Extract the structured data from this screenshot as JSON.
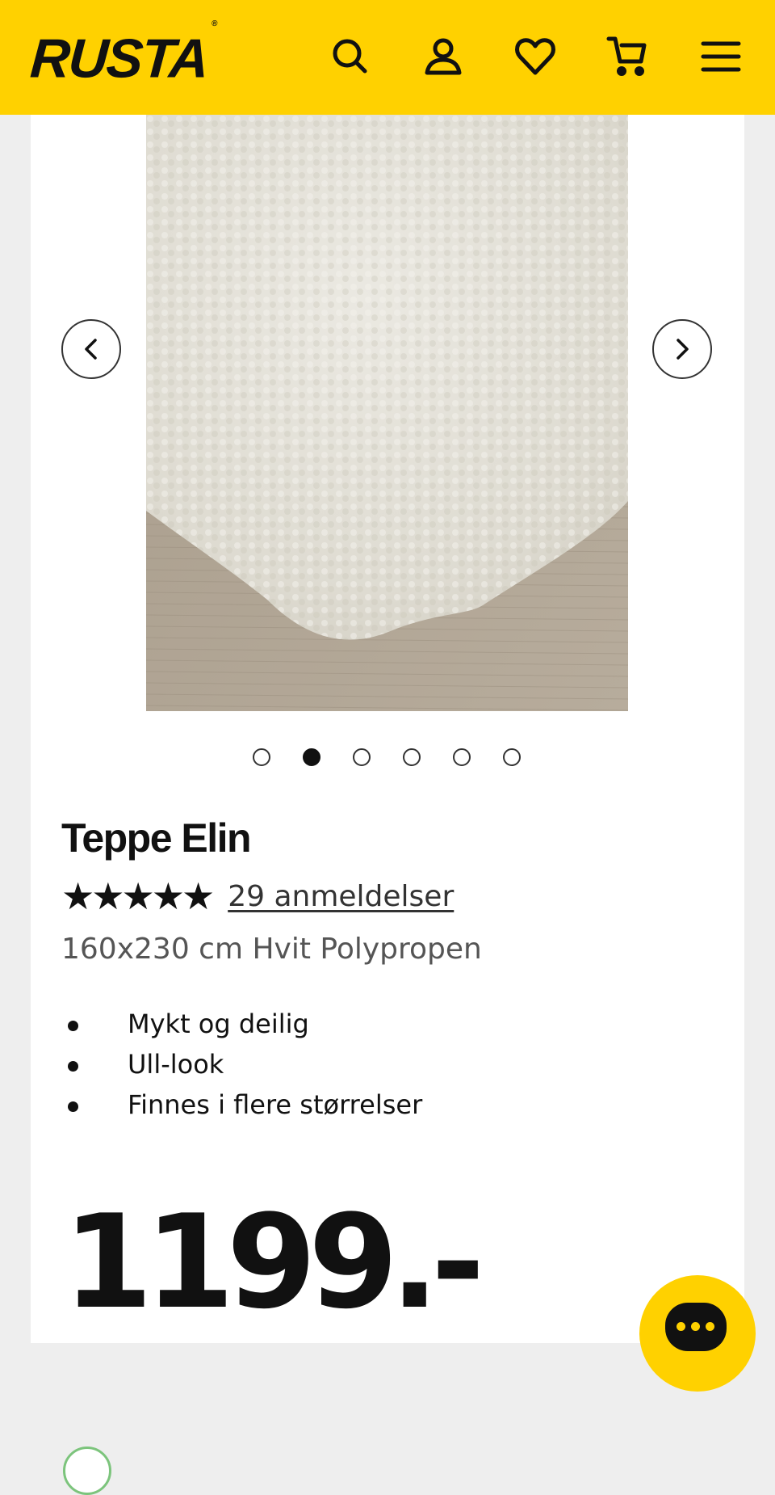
{
  "header": {
    "logo_text": "RUSTA",
    "logo_mark": "®",
    "background_color": "#ffd100",
    "icons": [
      "search-icon",
      "account-icon",
      "heart-icon",
      "cart-icon",
      "menu-icon"
    ]
  },
  "gallery": {
    "image_alt": "white shaggy rug on wooden floor",
    "prev_icon": "chevron-left-icon",
    "next_icon": "chevron-right-icon",
    "slide_count": 6,
    "active_slide": 2
  },
  "product": {
    "title": "Teppe Elin",
    "stars": "★★★★★",
    "rating_value": 5,
    "reviews_link": "29 anmeldelser",
    "subtitle": "160x230 cm Hvit Polypropen",
    "features": [
      "Mykt og deilig",
      "Ull-look",
      "Finnes i flere størrelser"
    ],
    "price": "1199.-"
  },
  "chat": {
    "icon": "chat-icon"
  }
}
